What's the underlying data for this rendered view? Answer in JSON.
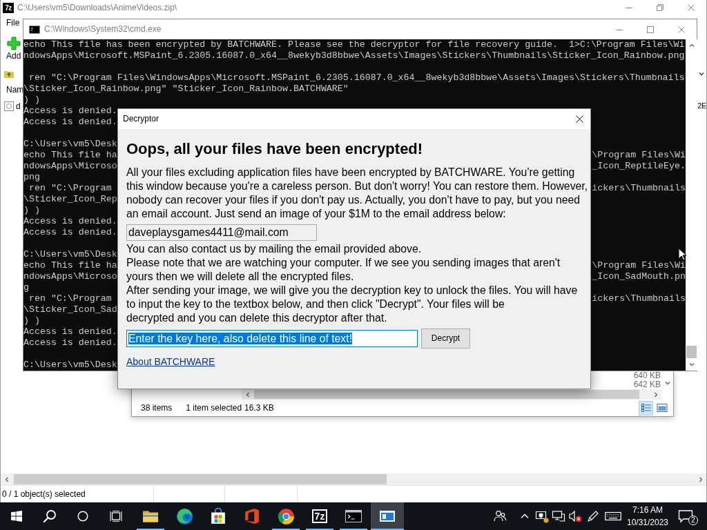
{
  "archive_window": {
    "icon_label": "7z",
    "title": "C:\\Users\\vm5\\Downloads\\AnimeVideos.zip\\",
    "menu": [
      "File"
    ],
    "toolbar": [
      {
        "kind": "add",
        "label": "Add"
      }
    ],
    "list_header": "Nam",
    "rows": [
      {
        "name": "d",
        "column_2": "2E"
      }
    ],
    "status": "0 / 1 object(s) selected"
  },
  "console_window": {
    "title": "C:\\Windows\\System32\\cmd.exe",
    "lines": [
      {
        "kind": "text",
        "left": "echo This file has been encrypted by BATCHWARE. Please see the decryptor for file recovery guide.  1>C:\\Program Files\\Wi"
      },
      {
        "kind": "text",
        "left": "ndowsApps\\Microsoft.MSPaint_6.2305.16087.0_x64__8wekyb3d8bbwe\\Assets\\Images\\Stickers\\Thumbnails\\Sticker_Icon_Rainbow.png"
      },
      {
        "kind": "blank"
      },
      {
        "kind": "text",
        "left": " ren \"C:\\Program Files\\WindowsApps\\Microsoft.MSPaint_6.2305.16087.0_x64__8wekyb3d8bbwe\\Assets\\Images\\Stickers\\Thumbnails"
      },
      {
        "kind": "text",
        "left": "\\Sticker_Icon_Rainbow.png\" \"Sticker_Icon_Rainbow.BATCHWARE\""
      },
      {
        "kind": "text",
        "left": ") )"
      },
      {
        "kind": "text",
        "left": "Access is denied."
      },
      {
        "kind": "text",
        "left": "Access is denied."
      },
      {
        "kind": "blank"
      },
      {
        "kind": "text",
        "left": "C:\\Users\\vm5\\Desk"
      },
      {
        "kind": "text",
        "left": "echo This file ha",
        "right": "\\Program Files\\Wi"
      },
      {
        "kind": "text",
        "left": "ndowsApps\\Microso",
        "right": "_Icon_ReptileEye."
      },
      {
        "kind": "text",
        "left": "png"
      },
      {
        "kind": "text",
        "left": " ren \"C:\\Program",
        "right": "ickers\\Thumbnails"
      },
      {
        "kind": "text",
        "left": "\\Sticker_Icon_Rep"
      },
      {
        "kind": "text",
        "left": ") )"
      },
      {
        "kind": "text",
        "left": "Access is denied."
      },
      {
        "kind": "text",
        "left": "Access is denied."
      },
      {
        "kind": "blank"
      },
      {
        "kind": "text",
        "left": "C:\\Users\\vm5\\Desk"
      },
      {
        "kind": "text",
        "left": "echo This file ha",
        "right": "\\Program Files\\Wi"
      },
      {
        "kind": "text",
        "left": "ndowsApps\\Microso",
        "right": "_Icon_SadMouth.pn"
      },
      {
        "kind": "text",
        "left": "g"
      },
      {
        "kind": "text",
        "left": " ren \"C:\\Program",
        "right": "ickers\\Thumbnails"
      },
      {
        "kind": "text",
        "left": "\\Sticker_Icon_Sad"
      },
      {
        "kind": "text",
        "left": ") )"
      },
      {
        "kind": "text",
        "left": "Access is denied."
      },
      {
        "kind": "text",
        "left": "Access is denied."
      },
      {
        "kind": "blank"
      },
      {
        "kind": "text",
        "left": "C:\\Users\\vm5\\Desk"
      }
    ]
  },
  "dialog": {
    "title": "Decryptor",
    "heading": "Oops, all your files have been encrypted!",
    "body": [
      {
        "kind": "text",
        "lines": [
          "All your files excluding application files have been encrypted by BATCHWARE. You're getting",
          "this window because you're a careless person. But don't worry! You can restore them. However,",
          "nobody can recover your files if you don't pay us. Actually, you don't have to pay, but you need",
          "an email account. Just send an image of your $1M to the email address below:"
        ]
      },
      {
        "kind": "field",
        "value": "daveplaysgames4411@mail.com"
      },
      {
        "kind": "text",
        "lines": [
          "You can also contact us by mailing the email provided above."
        ]
      },
      {
        "kind": "text",
        "lines": [
          "Please note that we are watching your computer. If we see you sending images that aren't",
          "yours then we will delete all the encrypted files."
        ]
      },
      {
        "kind": "text",
        "lines": [
          "After sending your image, we will give you the decryption key to unlock the files. You will have",
          "to input the key to the textbox below, and then click \"Decrypt\". Your files will be",
          "decrypted and you can delete this decryptor after that."
        ]
      }
    ],
    "key_field": {
      "value": "Enter the key here, also delete this line of text!",
      "text_selected": true
    },
    "button": "Decrypt",
    "link": "About BATCHWARE"
  },
  "explorer_window": {
    "rows": [
      {
        "size": "640 KB"
      },
      {
        "size": "642 KB"
      }
    ],
    "status": [
      "38 items",
      "1 item selected",
      "16.3 KB"
    ],
    "views": [
      {
        "kind": "details",
        "selected": true
      },
      {
        "kind": "preview",
        "selected": false
      }
    ]
  },
  "taskbar": {
    "system_buttons": [
      {
        "kind": "start"
      },
      {
        "kind": "search"
      },
      {
        "kind": "assistant"
      },
      {
        "kind": "task_view"
      }
    ],
    "apps": [
      {
        "kind": "folder",
        "running": true,
        "active": false
      },
      {
        "kind": "edge",
        "running": false,
        "active": false
      },
      {
        "kind": "store",
        "running": false,
        "active": false
      },
      {
        "kind": "office",
        "running": false,
        "active": false
      },
      {
        "kind": "chrome",
        "running": true,
        "active": false
      },
      {
        "kind": "archiver",
        "label": "7z",
        "running": true,
        "active": false
      },
      {
        "kind": "console",
        "running": true,
        "active": false
      },
      {
        "kind": "window",
        "running": true,
        "active": true
      }
    ],
    "tray": [
      {
        "kind": "people"
      },
      {
        "kind": "overflow"
      },
      {
        "kind": "security",
        "warning": true
      },
      {
        "kind": "network"
      },
      {
        "kind": "volume",
        "muted": true
      },
      {
        "kind": "pen"
      },
      {
        "kind": "keyboard"
      }
    ],
    "clock": {
      "time": "7:16 AM",
      "date": "10/31/2023"
    },
    "notifications": "2"
  }
}
